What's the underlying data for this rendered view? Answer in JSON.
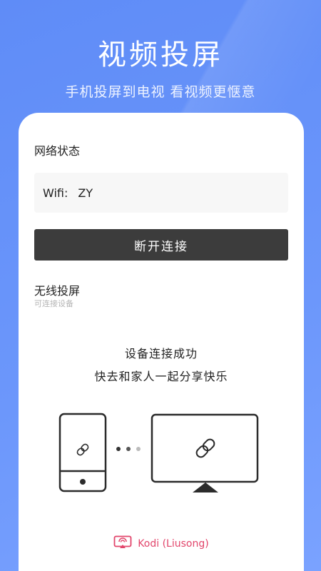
{
  "header": {
    "title": "视频投屏",
    "subtitle": "手机投屏到电视 看视频更惬意"
  },
  "network": {
    "section_title": "网络状态",
    "wifi_label": "Wifi:",
    "wifi_name": "ZY",
    "disconnect_label": "断开连接"
  },
  "wireless": {
    "section_title": "无线投屏",
    "subtitle": "可连接设备"
  },
  "status": {
    "line1": "设备连接成功",
    "line2": "快去和家人一起分享快乐"
  },
  "device": {
    "name": "Kodi (Liusong)",
    "icon": "cast-screen-icon"
  },
  "illustration": {
    "phone_icon": "link-icon",
    "tv_icon": "link-icon",
    "dots": [
      "#333333",
      "#555555",
      "#bbbbbb"
    ]
  },
  "colors": {
    "background": "#6a95fb",
    "button": "#3c3c3c",
    "device_accent": "#e2456b"
  }
}
